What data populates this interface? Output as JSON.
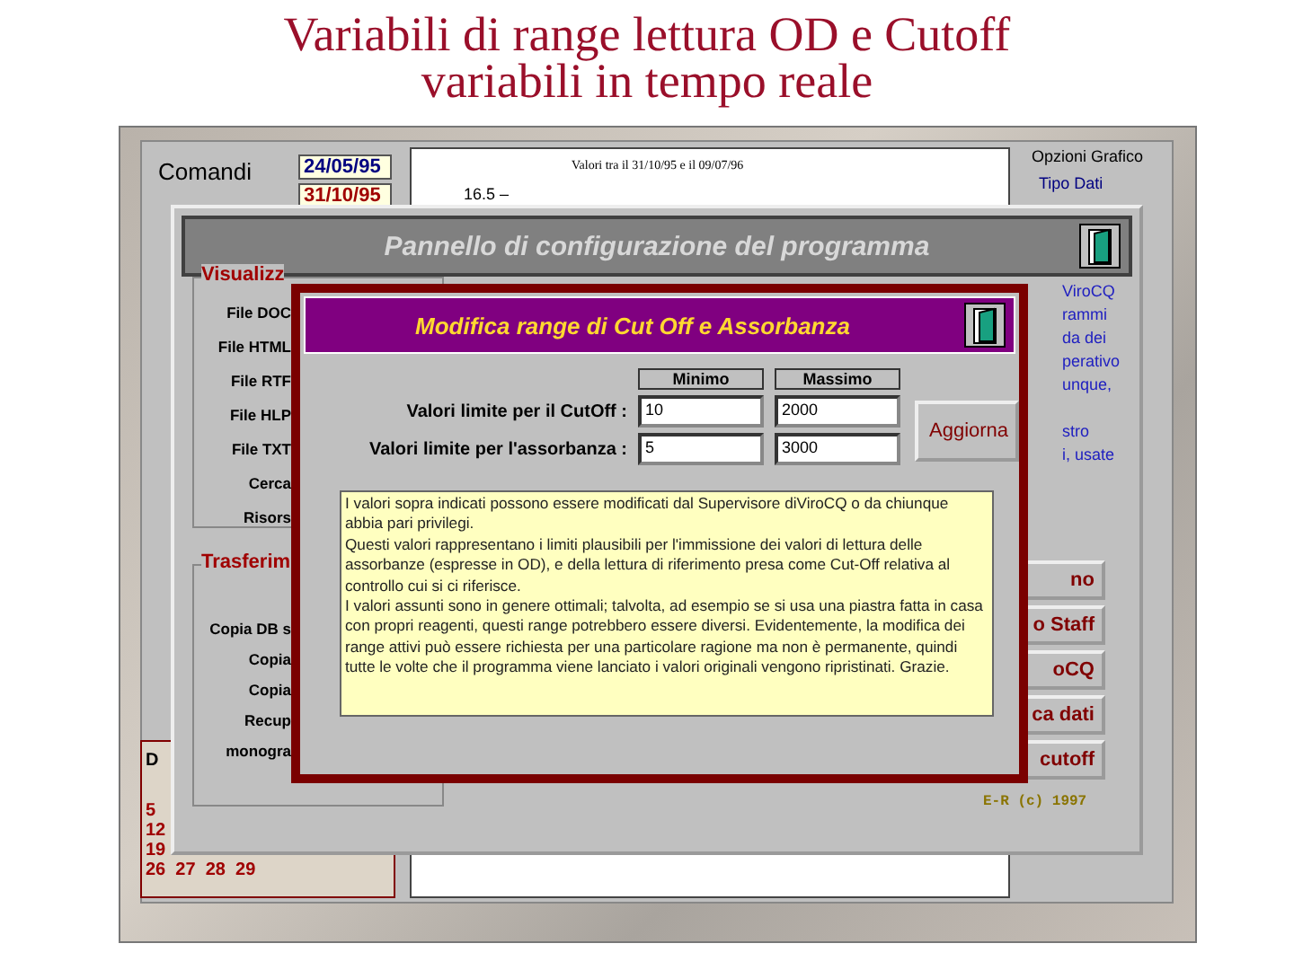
{
  "slide_title": [
    "Variabili di range lettura OD e Cutoff",
    "variabili in tempo reale"
  ],
  "back_app": {
    "commands_label": "Comandi",
    "dates": [
      "24/05/95",
      "31/10/95"
    ],
    "chart_title": "Valori tra il 31/10/95 e il 09/07/96",
    "chart_tick": "16.5 –",
    "options_title": "Opzioni Grafico",
    "options_group": "Tipo Dati",
    "calendar_head": "D",
    "calendar_rows": [
      "5",
      "12",
      "19",
      "26  27  28  29"
    ]
  },
  "config_panel": {
    "title": "Pannello di configurazione del programma",
    "group_1": {
      "title": "Visualizz",
      "labels": [
        "File DOC",
        "File HTML",
        "File RTF",
        "File HLP",
        "File TXT",
        "Cerca",
        "Risors"
      ]
    },
    "group_2": {
      "title": "Trasferim",
      "labels": [
        "Copia DB s",
        "Copia",
        "Copia",
        "Recup",
        "monogra"
      ]
    },
    "info_paragraphs": [
      [
        "ViroCQ",
        "rammi",
        "da dei",
        "perativo",
        "unque,"
      ],
      [
        "stro",
        "i, usate"
      ]
    ],
    "buttons": [
      "no",
      "o Staff",
      "oCQ",
      "ca dati",
      "cutoff"
    ],
    "credit": "E-R (c) 1997"
  },
  "dialog": {
    "title": "Modifica range di Cut Off e Assorbanza",
    "columns": [
      "Minimo",
      "Massimo"
    ],
    "rows": [
      {
        "label": "Valori limite per il CutOff :",
        "min": "10",
        "max": "2000"
      },
      {
        "label": "Valori limite per l'assorbanza :",
        "min": "5",
        "max": "3000"
      }
    ],
    "button": "Aggiorna",
    "note": "I valori sopra indicati possono essere modificati dal Supervisore diViroCQ o da chiunque abbia pari privilegi.\nQuesti valori rappresentano i limiti plausibili per l'immissione dei valori di lettura delle assorbanze (espresse in OD), e della lettura di riferimento presa come Cut-Off relativa al controllo cui si ci riferisce.\nI valori assunti sono in genere ottimali; talvolta, ad esempio se si usa una piastra fatta in casa con propri reagenti, questi range potrebbero essere diversi. Evidentemente, la modifica dei range attivi può essere richiesta per una particolare ragione ma non è permanente, quindi tutte le volte che il programma viene lanciato i valori originali vengono ripristinati. Grazie."
  }
}
